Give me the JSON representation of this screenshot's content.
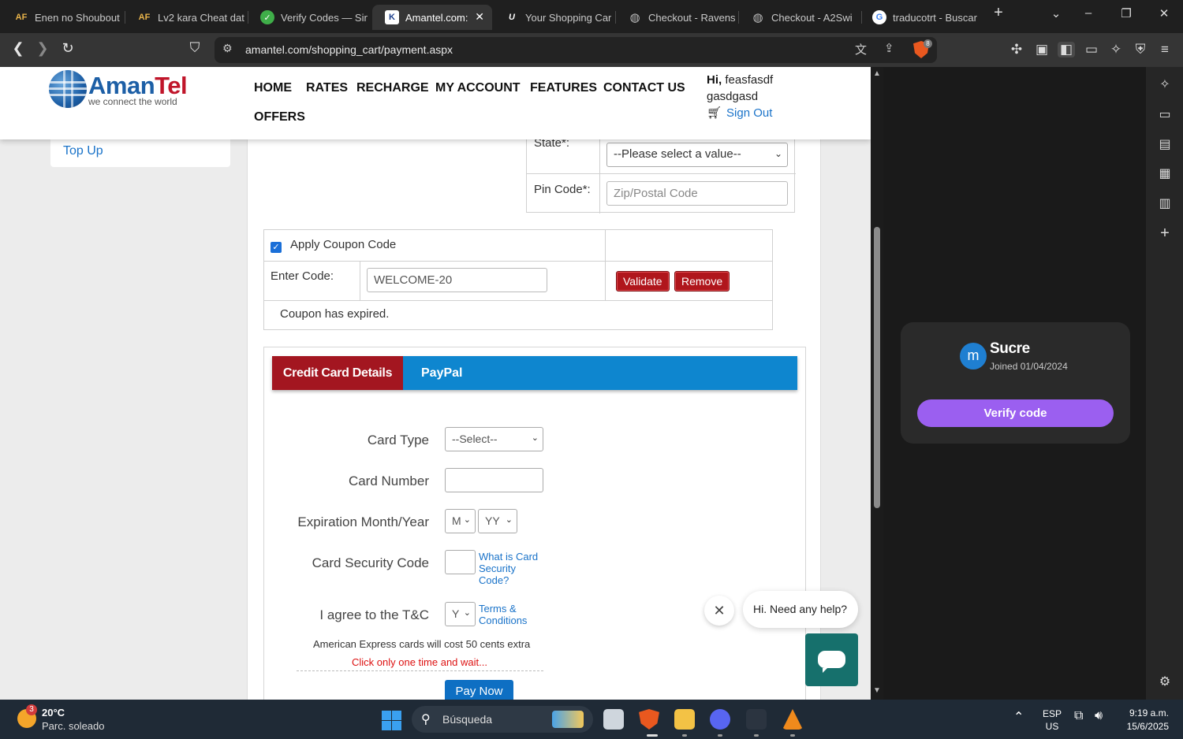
{
  "browser": {
    "tabs": [
      {
        "title": "Enen no Shoubout",
        "favicon": "AF"
      },
      {
        "title": "Lv2 kara Cheat dat",
        "favicon": "AF"
      },
      {
        "title": "Verify Codes — Sin",
        "favicon": "check"
      },
      {
        "title": "Amantel.com:",
        "favicon": "K"
      },
      {
        "title": "Your Shopping Car",
        "favicon": "U"
      },
      {
        "title": "Checkout - Ravens",
        "favicon": "globe"
      },
      {
        "title": "Checkout - A2Swi",
        "favicon": "globe"
      },
      {
        "title": "traducotrt - Buscar",
        "favicon": "G"
      }
    ],
    "url": "amantel.com/shopping_cart/payment.aspx",
    "shield_count": "8"
  },
  "site": {
    "logo_name_a": "Aman",
    "logo_name_b": "Tel",
    "logo_tagline": "we connect the world",
    "nav": [
      "HOME",
      "RATES",
      "RECHARGE",
      "MY ACCOUNT",
      "FEATURES",
      "CONTACT US",
      "OFFERS"
    ],
    "greeting_prefix": "Hi,",
    "user_first": "feasfasdf",
    "user_last": "gasdgasd",
    "signout": "Sign Out",
    "sidebar_topup": "Top Up"
  },
  "address": {
    "state_label": "State*:",
    "state_select": "--Please select a value--",
    "pin_label": "Pin Code*:",
    "pin_placeholder": "Zip/Postal Code"
  },
  "coupon": {
    "apply_label": "Apply Coupon Code",
    "apply_checked": true,
    "enter_label": "Enter Code:",
    "code_value": "WELCOME-20",
    "validate": "Validate",
    "remove": "Remove",
    "message": "Coupon has expired."
  },
  "payment": {
    "tab_card": "Credit Card Details",
    "tab_paypal": "PayPal",
    "card_type_label": "Card Type",
    "card_type_value": "--Select--",
    "card_number_label": "Card Number",
    "card_number_value": "",
    "exp_label": "Expiration Month/Year",
    "exp_month": "M",
    "exp_year": "YY",
    "csc_label": "Card Security Code",
    "csc_value": "",
    "csc_help_1": "What is Card",
    "csc_help_2": "Security",
    "csc_help_3": "Code?",
    "tc_label": "I agree to the T&C",
    "tc_value": "Y",
    "tc_link_1": "Terms &",
    "tc_link_2": "Conditions",
    "amex_note": "American Express cards will cost 50 cents extra",
    "click_note": "Click only one time and wait...",
    "pay_now": "Pay Now"
  },
  "chat": {
    "bubble": "Hi. Need any help?"
  },
  "sidepanel": {
    "avatar_letter": "m",
    "name": "Sucre",
    "joined": "Joined 01/04/2024",
    "verify_button": "Verify code"
  },
  "taskbar": {
    "weather_badge": "3",
    "temperature": "20°C",
    "condition": "Parc. soleado",
    "search_placeholder": "Búsqueda",
    "lang_1": "ESP",
    "lang_2": "US",
    "time": "9:19 a.m.",
    "date": "15/6/2025"
  },
  "colors": {
    "brand_red": "#b0161c",
    "brand_blue": "#0e86cf",
    "link_blue": "#1a73c9",
    "verify_purple": "#9b5ff0"
  }
}
